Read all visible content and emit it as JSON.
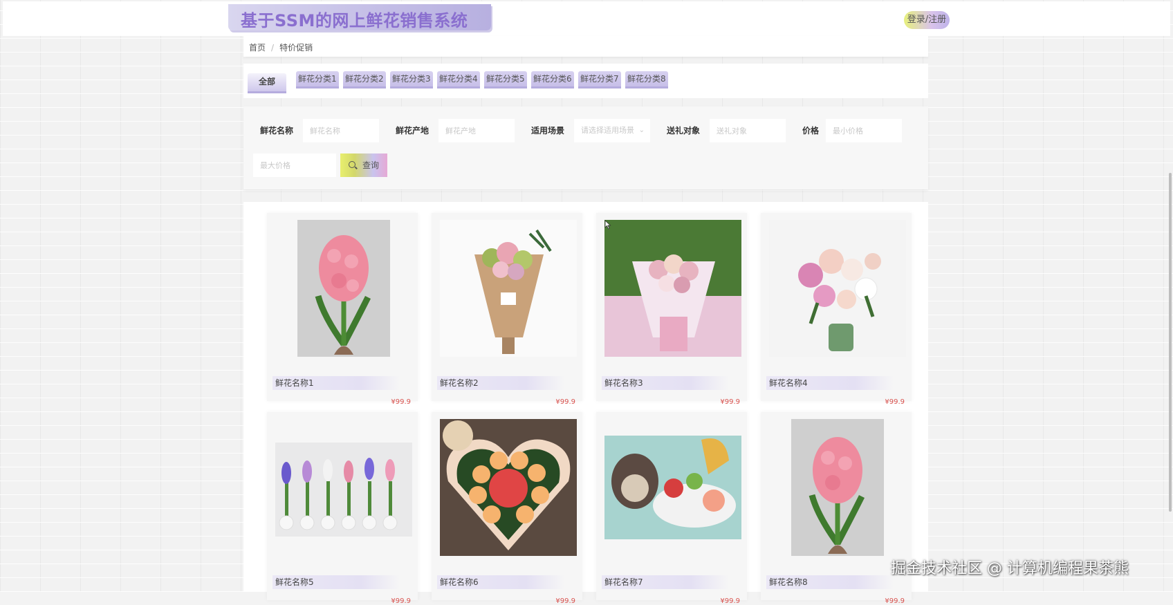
{
  "header": {
    "brand_title": "基于SSM的网上鲜花销售系统",
    "login_label": "登录/注册"
  },
  "breadcrumb": {
    "home": "首页",
    "separator": "/",
    "current": "特价促销"
  },
  "tabs": [
    {
      "label": "全部",
      "active": true
    },
    {
      "label": "鲜花分类1"
    },
    {
      "label": "鲜花分类2"
    },
    {
      "label": "鲜花分类3"
    },
    {
      "label": "鲜花分类4"
    },
    {
      "label": "鲜花分类5"
    },
    {
      "label": "鲜花分类6"
    },
    {
      "label": "鲜花分类7"
    },
    {
      "label": "鲜花分类8"
    }
  ],
  "search": {
    "name_label": "鲜花名称",
    "name_placeholder": "鲜花名称",
    "origin_label": "鲜花产地",
    "origin_placeholder": "鲜花产地",
    "scene_label": "适用场景",
    "scene_placeholder": "请选择适用场景",
    "recipient_label": "送礼对象",
    "recipient_placeholder": "送礼对象",
    "price_label": "价格",
    "price_min_placeholder": "最小价格",
    "price_max_placeholder": "最大价格",
    "search_button": "查询"
  },
  "products": [
    {
      "name": "鲜花名称1",
      "price": "¥99.9"
    },
    {
      "name": "鲜花名称2",
      "price": "¥99.9"
    },
    {
      "name": "鲜花名称3",
      "price": "¥99.9"
    },
    {
      "name": "鲜花名称4",
      "price": "¥99.9"
    },
    {
      "name": "鲜花名称5",
      "price": "¥99.9"
    },
    {
      "name": "鲜花名称6",
      "price": "¥99.9"
    },
    {
      "name": "鲜花名称7",
      "price": "¥99.9"
    },
    {
      "name": "鲜花名称8",
      "price": "¥99.9"
    }
  ],
  "watermark": "掘金技术社区 @ 计算机编程果茶熊",
  "colors": {
    "brand_text": "#8a6fcf",
    "tab_bg": "#c7bfe8",
    "price": "#d9534f"
  }
}
